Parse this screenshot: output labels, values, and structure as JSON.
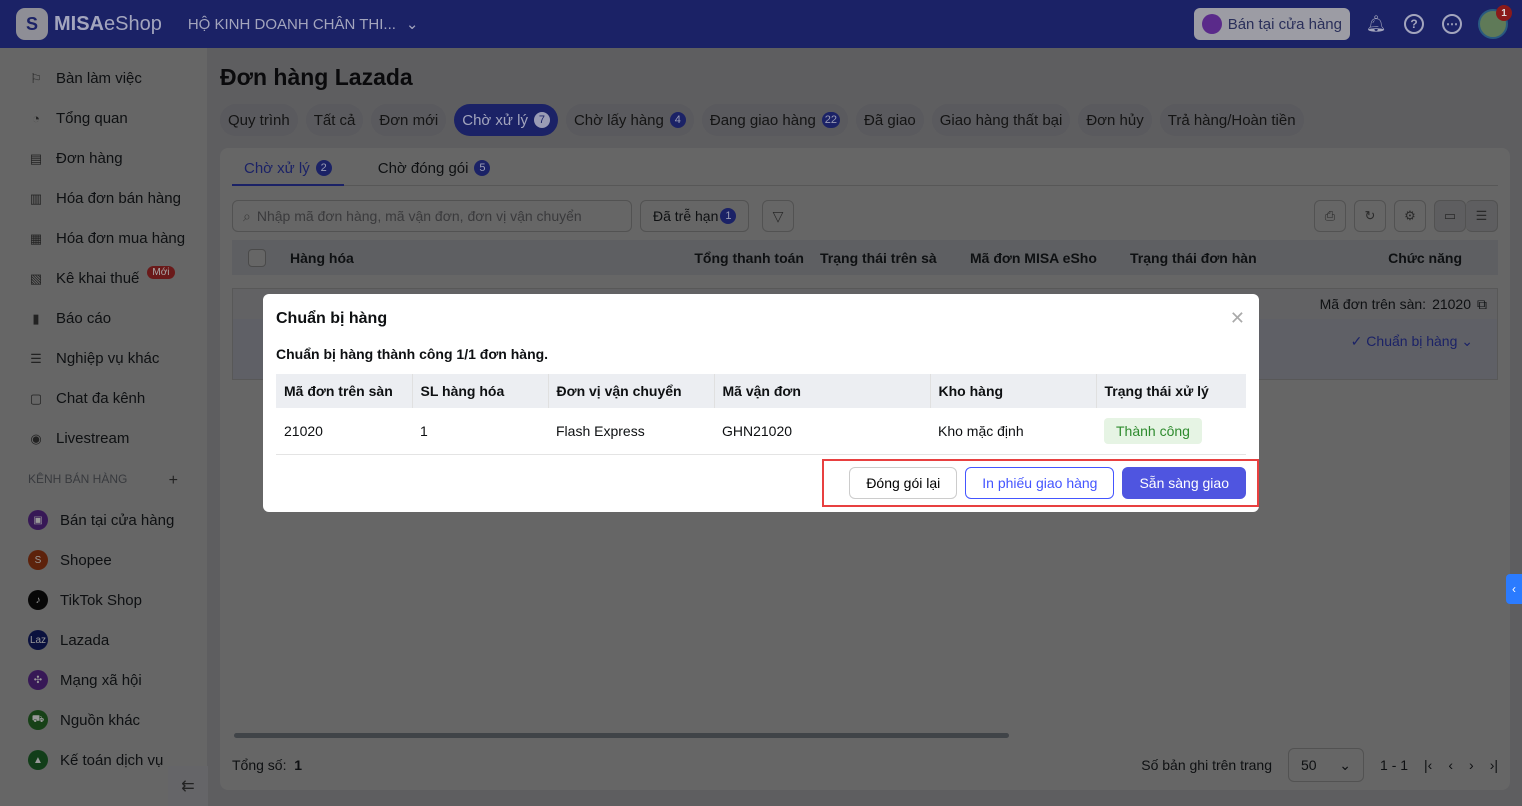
{
  "header": {
    "logo_bold": "MISA",
    "logo_light": "eShop",
    "shop_name": "HỘ KINH DOANH CHÂN THI...",
    "pos_button": "Bán tại cửa hàng",
    "notification_count": "1"
  },
  "sidebar": {
    "items": [
      {
        "label": "Bàn làm việc",
        "icon": "⚐"
      },
      {
        "label": "Tổng quan",
        "icon": "◔"
      },
      {
        "label": "Đơn hàng",
        "icon": "▤"
      },
      {
        "label": "Hóa đơn bán hàng",
        "icon": "▥"
      },
      {
        "label": "Hóa đơn mua hàng",
        "icon": "▦"
      },
      {
        "label": "Kê khai thuế",
        "icon": "▧",
        "badge": "Mới"
      },
      {
        "label": "Báo cáo",
        "icon": "▮"
      },
      {
        "label": "Nghiệp vụ khác",
        "icon": "☰"
      },
      {
        "label": "Chat đa kênh",
        "icon": "▢"
      },
      {
        "label": "Livestream",
        "icon": "◉"
      }
    ],
    "section_label": "KÊNH BÁN HÀNG",
    "channels": [
      {
        "label": "Bán tại cửa hàng",
        "color": "#8a3dd6",
        "glyph": "▣"
      },
      {
        "label": "Shopee",
        "color": "#e8541c",
        "glyph": "S"
      },
      {
        "label": "TikTok Shop",
        "color": "#111111",
        "glyph": "♪"
      },
      {
        "label": "Lazada",
        "color": "#1a2a9c",
        "glyph": "Laz"
      },
      {
        "label": "Mạng xã hội",
        "color": "#8a3dd6",
        "glyph": "✣"
      },
      {
        "label": "Nguồn khác",
        "color": "#3aa33a",
        "glyph": "⛟"
      },
      {
        "label": "Kế toán dịch vụ",
        "color": "#2e9a3e",
        "glyph": "▲"
      }
    ]
  },
  "page": {
    "title": "Đơn hàng Lazada",
    "tabs": [
      {
        "label": "Quy trình"
      },
      {
        "label": "Tất cả"
      },
      {
        "label": "Đơn mới"
      },
      {
        "label": "Chờ xử lý",
        "count": "7"
      },
      {
        "label": "Chờ lấy hàng",
        "count": "4"
      },
      {
        "label": "Đang giao hàng",
        "count": "22"
      },
      {
        "label": "Đã giao"
      },
      {
        "label": "Giao hàng thất bại"
      },
      {
        "label": "Đơn hủy"
      },
      {
        "label": "Trả hàng/Hoàn tiền"
      }
    ],
    "subtabs": [
      {
        "label": "Chờ xử lý",
        "count": "2"
      },
      {
        "label": "Chờ đóng gói",
        "count": "5"
      }
    ],
    "search_placeholder": "Nhập mã đơn hàng, mã vận đơn, đơn vị vận chuyển",
    "late_filter": "Đã trễ hạn",
    "late_count": "1",
    "columns": [
      "Hàng hóa",
      "Tổng thanh toán",
      "Trạng thái trên sà",
      "Mã đơn MISA eSho",
      "Trạng thái đơn hàn",
      "Chức năng"
    ],
    "row": {
      "order_label": "Mã đơn trên sàn:",
      "order_id": "21020",
      "action": "Chuẩn bị hàng"
    },
    "footer": {
      "total_label": "Tổng số:",
      "total": "1",
      "per_page_label": "Số bản ghi trên trang",
      "per_page": "50",
      "range": "1 - 1"
    }
  },
  "modal": {
    "title": "Chuẩn bị hàng",
    "message": "Chuẩn bị hàng thành công 1/1 đơn hàng.",
    "columns": [
      "Mã đơn trên sàn",
      "SL hàng hóa",
      "Đơn vị vận chuyển",
      "Mã vận đơn",
      "Kho hàng",
      "Trạng thái xử lý"
    ],
    "rows": [
      {
        "order": "21020",
        "qty": "1",
        "carrier": "Flash Express",
        "tracking": "GHN21020",
        "warehouse": "Kho mặc định",
        "status": "Thành công"
      }
    ],
    "buttons": {
      "repack": "Đóng gói lại",
      "print": "In phiếu giao hàng",
      "ready": "Sẵn sàng giao"
    }
  }
}
